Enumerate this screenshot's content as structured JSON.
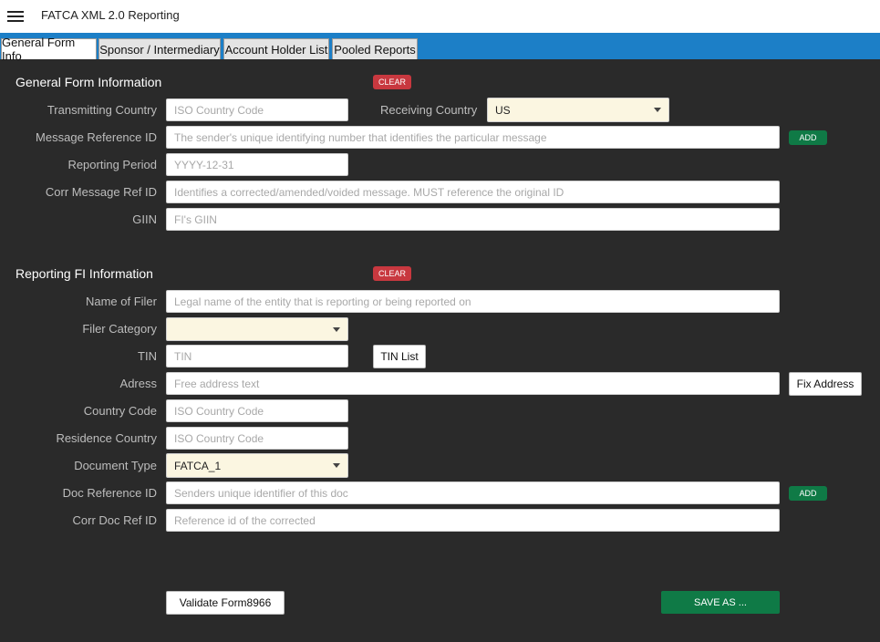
{
  "app": {
    "title": "FATCA XML 2.0 Reporting",
    "menu_icon": "hamburger-icon"
  },
  "tabs": [
    {
      "label": "General Form Info",
      "active": true
    },
    {
      "label": "Sponsor / Intermediary",
      "active": false
    },
    {
      "label": "Account Holder List",
      "active": false
    },
    {
      "label": "Pooled Reports",
      "active": false
    }
  ],
  "general": {
    "title": "General Form Information",
    "clear_label": "CLEAR",
    "add_label": "ADD",
    "transmitting_country": {
      "label": "Transmitting Country",
      "placeholder": "ISO Country Code"
    },
    "receiving_country": {
      "label": "Receiving Country",
      "value": "US"
    },
    "message_ref": {
      "label": "Message Reference ID",
      "placeholder": "The sender's unique identifying number that identifies the particular message"
    },
    "reporting_period": {
      "label": "Reporting Period",
      "placeholder": "YYYY-12-31"
    },
    "corr_message_ref": {
      "label": "Corr Message Ref ID",
      "placeholder": "Identifies a corrected/amended/voided message. MUST reference the original ID"
    },
    "giin": {
      "label": "GIIN",
      "placeholder": "FI's GIIN"
    }
  },
  "reporting_fi": {
    "title": "Reporting FI Information",
    "clear_label": "CLEAR",
    "add_label": "ADD",
    "name_of_filer": {
      "label": "Name of Filer",
      "placeholder": "Legal name of the entity that is reporting or being reported on"
    },
    "filer_category": {
      "label": "Filer Category",
      "value": ""
    },
    "tin": {
      "label": "TIN",
      "placeholder": "TIN",
      "list_button": "TIN List"
    },
    "address": {
      "label": "Adress",
      "placeholder": "Free address text",
      "fix_button": "Fix Address"
    },
    "country_code": {
      "label": "Country Code",
      "placeholder": "ISO Country Code"
    },
    "residence_country": {
      "label": "Residence Country",
      "placeholder": "ISO Country Code"
    },
    "document_type": {
      "label": "Document Type",
      "value": "FATCA_1"
    },
    "doc_ref": {
      "label": "Doc Reference ID",
      "placeholder": "Senders unique identifier of this doc"
    },
    "corr_doc_ref": {
      "label": "Corr Doc Ref ID",
      "placeholder": "Reference id of the corrected"
    }
  },
  "footer": {
    "validate_label": "Validate Form8966",
    "save_label": "SAVE AS ..."
  },
  "colors": {
    "tabbar": "#1c7fc7",
    "background": "#2a2a2a",
    "clear": "#c8383f",
    "add": "#0f7a46",
    "select_bg": "#fbf6e1"
  }
}
